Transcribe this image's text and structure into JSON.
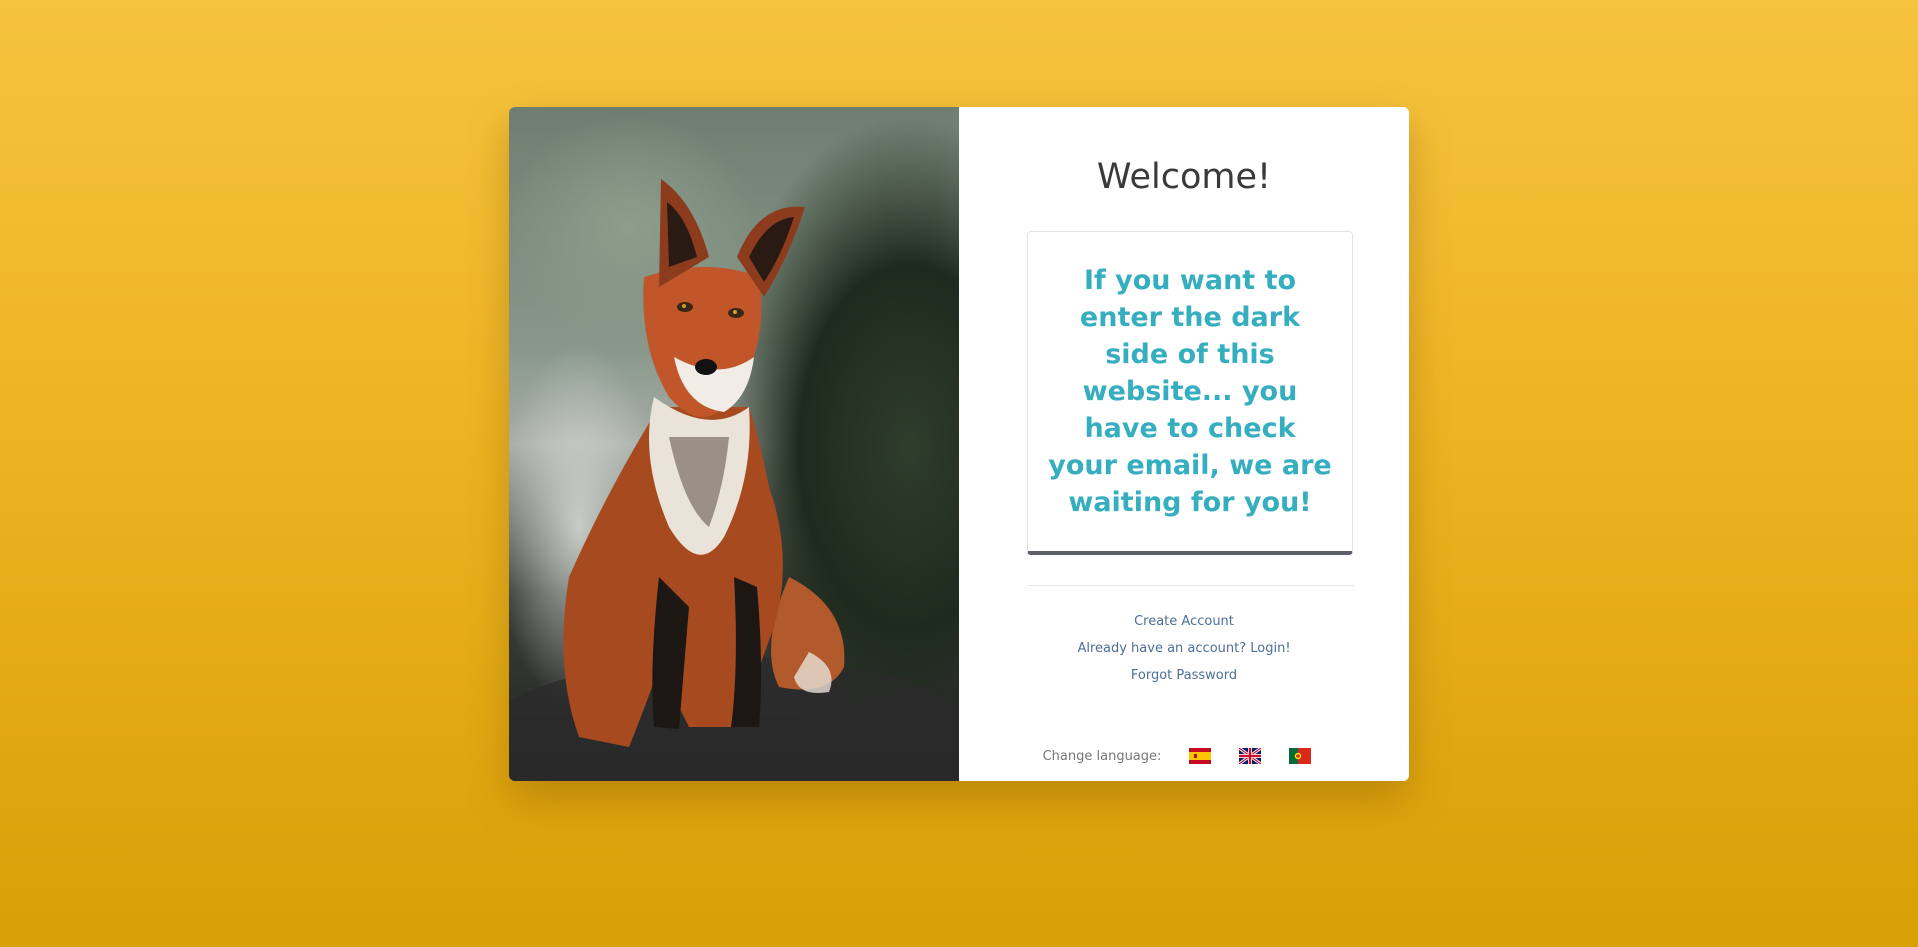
{
  "photo": {
    "alt": "fox-photo"
  },
  "panel": {
    "title": "Welcome!",
    "message": "If you want to enter the dark side of this website... you have to check your email, we are waiting for you!",
    "links": [
      {
        "label": "Create Account"
      },
      {
        "label": "Already have an account? Login!"
      },
      {
        "label": "Forgot Password"
      }
    ],
    "language": {
      "label": "Change language:",
      "flags": [
        {
          "icon": "spain-flag-icon"
        },
        {
          "icon": "uk-flag-icon"
        },
        {
          "icon": "portugal-flag-icon"
        }
      ]
    }
  },
  "colors": {
    "background_top": "#f6c33f",
    "background_bottom": "#d99f06",
    "message_text": "#35aec0",
    "link_text": "#4d6f96",
    "box_bottom_border": "#5d6068"
  }
}
